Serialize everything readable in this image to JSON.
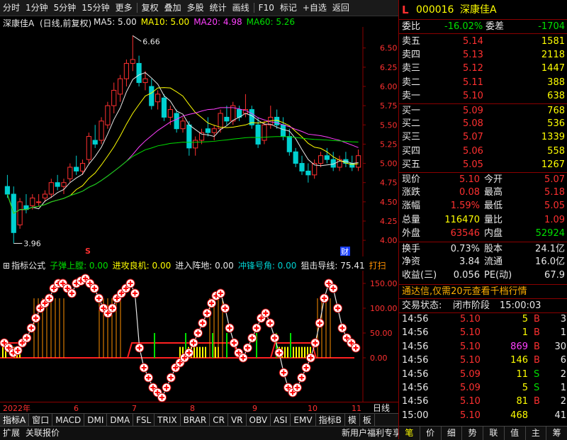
{
  "toolbar": {
    "items": [
      "分时",
      "1分钟",
      "5分钟",
      "15分钟",
      "更多",
      "复权",
      "叠加",
      "多股",
      "统计",
      "画线",
      "F10",
      "标记",
      "+自选",
      "返回"
    ]
  },
  "main_chart": {
    "name": "深康佳A",
    "adjust": "(日线,前复权)",
    "ma": [
      {
        "label": "MA5: 5.00",
        "color": "#e8e8e8"
      },
      {
        "label": "MA10: 5.00",
        "color": "#ffff00"
      },
      {
        "label": "MA20: 4.98",
        "color": "#ff40ff"
      },
      {
        "label": "MA60: 5.26",
        "color": "#00e000"
      }
    ],
    "high_label": "6.66",
    "low_label": "3.96",
    "y_ticks": [
      "6.50",
      "6.25",
      "6.00",
      "5.75",
      "5.50",
      "5.25",
      "5.00",
      "4.75",
      "4.50",
      "4.25",
      "4.00"
    ],
    "marker_s": "S",
    "marker_cai": "财"
  },
  "indicator": {
    "title": "指标公式",
    "lines": [
      {
        "label": "子弹上膛: 0.00",
        "color": "#00e000"
      },
      {
        "label": "进攻良机: 0.00",
        "color": "#ffff00"
      },
      {
        "label": "进入阵地: 0.00",
        "color": "#e8e8e8"
      },
      {
        "label": "冲锋号角: 0.00",
        "color": "#00d0d0"
      },
      {
        "label": "狙击导线: 75.41",
        "color": "#e8e8e8"
      },
      {
        "label": "打扫",
        "color": "#ff9000"
      }
    ],
    "y_ticks": [
      "150.00",
      "100.00",
      "50.00",
      "0.00"
    ]
  },
  "x_axis": {
    "labels": [
      "2022年",
      "6",
      "7",
      "8",
      "9",
      "10",
      "11"
    ],
    "period": "日线"
  },
  "tabs": [
    "指标A",
    "窗口",
    "MACD",
    "DMI",
    "DMA",
    "FSL",
    "TRIX",
    "BRAR",
    "CR",
    "VR",
    "OBV",
    "ASI",
    "EMV",
    "指标B",
    "模",
    "板"
  ],
  "status": {
    "left": [
      "扩展",
      "关联报价"
    ],
    "promo": "新用户福利专享"
  },
  "quote": {
    "logo": "L",
    "code": "000016",
    "name": "深康佳A",
    "weibi_label": "委比",
    "weibi": "-16.02%",
    "weicha_label": "委差",
    "weicha": "-1704",
    "asks": [
      {
        "label": "卖五",
        "price": "5.14",
        "vol": "1581"
      },
      {
        "label": "卖四",
        "price": "5.13",
        "vol": "2118"
      },
      {
        "label": "卖三",
        "price": "5.12",
        "vol": "1447"
      },
      {
        "label": "卖二",
        "price": "5.11",
        "vol": "388"
      },
      {
        "label": "卖一",
        "price": "5.10",
        "vol": "638"
      }
    ],
    "bids": [
      {
        "label": "买一",
        "price": "5.09",
        "vol": "768"
      },
      {
        "label": "买二",
        "price": "5.08",
        "vol": "536"
      },
      {
        "label": "买三",
        "price": "5.07",
        "vol": "1339"
      },
      {
        "label": "买四",
        "price": "5.06",
        "vol": "558"
      },
      {
        "label": "买五",
        "price": "5.05",
        "vol": "1267"
      }
    ],
    "stats": [
      {
        "l1": "现价",
        "v1": "5.10",
        "c1": "red",
        "l2": "今开",
        "v2": "5.07",
        "c2": "red"
      },
      {
        "l1": "涨跌",
        "v1": "0.08",
        "c1": "red",
        "l2": "最高",
        "v2": "5.18",
        "c2": "red"
      },
      {
        "l1": "涨幅",
        "v1": "1.59%",
        "c1": "red",
        "l2": "最低",
        "v2": "5.05",
        "c2": "red"
      },
      {
        "l1": "总量",
        "v1": "116470",
        "c1": "yellow",
        "l2": "量比",
        "v2": "1.09",
        "c2": "red"
      },
      {
        "l1": "外盘",
        "v1": "63546",
        "c1": "red",
        "l2": "内盘",
        "v2": "52924",
        "c2": "green"
      }
    ],
    "fund": [
      {
        "l1": "换手",
        "v1": "0.73%",
        "l2": "股本",
        "v2": "24.1亿"
      },
      {
        "l1": "净资",
        "v1": "3.84",
        "l2": "流通",
        "v2": "16.0亿"
      },
      {
        "l1": "收益(三)",
        "v1": "0.056",
        "l2": "PE(动)",
        "v2": "67.9"
      }
    ],
    "promo": "通达信,仅需20元查看千档行情",
    "trade_status_label": "交易状态:",
    "trade_status": "闭市阶段",
    "trade_time": "15:00:03",
    "ticks": [
      {
        "t": "14:56",
        "p": "5.10",
        "v": "5",
        "d": "B",
        "n": "3",
        "vc": "yellow",
        "dc": "red"
      },
      {
        "t": "14:56",
        "p": "5.10",
        "v": "1",
        "d": "B",
        "n": "1",
        "vc": "yellow",
        "dc": "red"
      },
      {
        "t": "14:56",
        "p": "5.10",
        "v": "869",
        "d": "B",
        "n": "30",
        "vc": "magenta",
        "dc": "red"
      },
      {
        "t": "14:56",
        "p": "5.10",
        "v": "146",
        "d": "B",
        "n": "6",
        "vc": "yellow",
        "dc": "red"
      },
      {
        "t": "14:56",
        "p": "5.09",
        "v": "11",
        "d": "S",
        "n": "2",
        "vc": "yellow",
        "dc": "green"
      },
      {
        "t": "14:56",
        "p": "5.09",
        "v": "5",
        "d": "S",
        "n": "1",
        "vc": "yellow",
        "dc": "green"
      },
      {
        "t": "14:56",
        "p": "5.10",
        "v": "81",
        "d": "B",
        "n": "2",
        "vc": "yellow",
        "dc": "red"
      },
      {
        "t": "15:00",
        "p": "5.10",
        "v": "468",
        "d": "",
        "n": "41",
        "vc": "yellow",
        "dc": "red"
      }
    ],
    "bottom_tabs": [
      "笔",
      "价",
      "细",
      "势",
      "联",
      "值",
      "主",
      "筹"
    ]
  },
  "chart_data": {
    "type": "candlestick",
    "ylim": [
      3.9,
      6.7
    ],
    "candles": [
      [
        4.7,
        4.85,
        4.55,
        4.6
      ],
      [
        4.6,
        4.7,
        3.96,
        4.1
      ],
      [
        4.2,
        4.55,
        4.15,
        4.5
      ],
      [
        4.45,
        4.6,
        4.35,
        4.4
      ],
      [
        4.45,
        4.6,
        4.4,
        4.55
      ],
      [
        4.5,
        4.6,
        4.45,
        4.5
      ],
      [
        4.55,
        4.65,
        4.5,
        4.6
      ],
      [
        4.6,
        4.8,
        4.55,
        4.75
      ],
      [
        4.75,
        4.85,
        4.65,
        4.7
      ],
      [
        4.7,
        4.8,
        4.6,
        4.75
      ],
      [
        4.8,
        5.0,
        4.75,
        4.95
      ],
      [
        4.95,
        5.1,
        4.85,
        4.9
      ],
      [
        4.9,
        5.05,
        4.85,
        5.0
      ],
      [
        5.05,
        5.4,
        5.0,
        5.35
      ],
      [
        5.3,
        5.5,
        5.2,
        5.25
      ],
      [
        5.3,
        5.6,
        5.25,
        5.55
      ],
      [
        5.5,
        5.8,
        5.45,
        5.75
      ],
      [
        5.75,
        6.05,
        5.65,
        5.95
      ],
      [
        5.9,
        6.15,
        5.8,
        6.1
      ],
      [
        6.1,
        6.35,
        6.0,
        6.3
      ],
      [
        6.3,
        6.66,
        6.2,
        6.35
      ],
      [
        6.3,
        6.4,
        6.0,
        6.05
      ],
      [
        6.05,
        6.2,
        5.95,
        6.1
      ],
      [
        6.0,
        6.1,
        5.7,
        5.75
      ],
      [
        5.8,
        5.95,
        5.7,
        5.9
      ],
      [
        5.85,
        5.9,
        5.55,
        5.6
      ],
      [
        5.6,
        5.75,
        5.5,
        5.7
      ],
      [
        5.65,
        5.7,
        5.4,
        5.45
      ],
      [
        5.45,
        5.6,
        5.4,
        5.55
      ],
      [
        5.5,
        5.55,
        5.1,
        5.2
      ],
      [
        5.2,
        5.35,
        5.1,
        5.3
      ],
      [
        5.3,
        5.45,
        5.25,
        5.4
      ],
      [
        5.45,
        5.6,
        5.35,
        5.4
      ],
      [
        5.4,
        5.5,
        5.3,
        5.45
      ],
      [
        5.45,
        5.7,
        5.4,
        5.65
      ],
      [
        5.6,
        5.75,
        5.5,
        5.55
      ],
      [
        5.55,
        5.8,
        5.5,
        5.75
      ],
      [
        5.7,
        5.75,
        5.55,
        5.6
      ],
      [
        5.65,
        5.9,
        5.6,
        5.7
      ],
      [
        5.7,
        5.75,
        5.45,
        5.5
      ],
      [
        5.5,
        5.6,
        5.2,
        5.25
      ],
      [
        5.3,
        5.55,
        5.25,
        5.5
      ],
      [
        5.5,
        5.75,
        5.45,
        5.6
      ],
      [
        5.6,
        5.7,
        5.45,
        5.5
      ],
      [
        5.5,
        5.6,
        5.3,
        5.35
      ],
      [
        5.35,
        5.45,
        5.1,
        5.15
      ],
      [
        5.15,
        5.2,
        4.95,
        5.0
      ],
      [
        5.0,
        5.1,
        4.85,
        4.9
      ],
      [
        4.9,
        5.0,
        4.75,
        4.85
      ],
      [
        4.85,
        5.05,
        4.8,
        5.0
      ],
      [
        5.0,
        5.15,
        4.95,
        5.1
      ],
      [
        5.1,
        5.2,
        5.0,
        5.05
      ],
      [
        5.05,
        5.15,
        4.9,
        4.95
      ],
      [
        4.95,
        5.1,
        4.9,
        5.05
      ],
      [
        5.05,
        5.15,
        4.95,
        5.0
      ],
      [
        5.0,
        5.1,
        4.9,
        4.95
      ],
      [
        4.95,
        5.18,
        4.9,
        5.1
      ]
    ],
    "ind_line": [
      30,
      20,
      10,
      15,
      30,
      40,
      60,
      80,
      100,
      110,
      120,
      140,
      150,
      150,
      140,
      130,
      150,
      155,
      160,
      150,
      140,
      120,
      100,
      90,
      100,
      120,
      130,
      140,
      150,
      130,
      20,
      -20,
      -40,
      -60,
      -70,
      -80,
      -60,
      -40,
      -20,
      -10,
      0,
      10,
      30,
      50,
      70,
      90,
      110,
      125,
      130,
      100,
      60,
      30,
      10,
      0,
      20,
      40,
      60,
      80,
      90,
      70,
      40,
      10,
      -30,
      -60,
      -70,
      -60,
      -40,
      -20,
      0,
      30,
      70,
      120,
      150,
      140,
      100,
      60,
      40,
      30,
      20
    ]
  }
}
